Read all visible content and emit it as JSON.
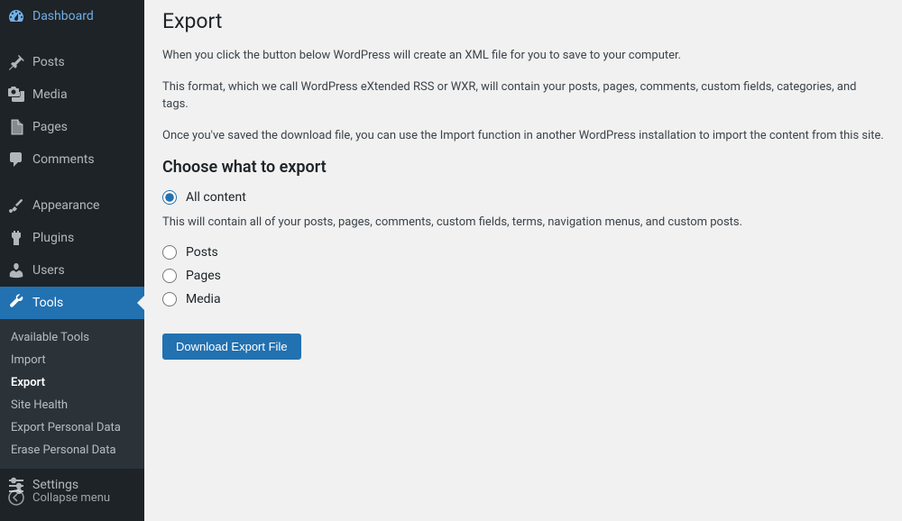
{
  "sidebar": {
    "dashboard": "Dashboard",
    "posts": "Posts",
    "media": "Media",
    "pages": "Pages",
    "comments": "Comments",
    "appearance": "Appearance",
    "plugins": "Plugins",
    "users": "Users",
    "tools": "Tools",
    "settings": "Settings",
    "collapse": "Collapse menu",
    "submenu": {
      "available_tools": "Available Tools",
      "import": "Import",
      "export": "Export",
      "site_health": "Site Health",
      "export_personal": "Export Personal Data",
      "erase_personal": "Erase Personal Data"
    }
  },
  "main": {
    "title": "Export",
    "p1": "When you click the button below WordPress will create an XML file for you to save to your computer.",
    "p2": "This format, which we call WordPress eXtended RSS or WXR, will contain your posts, pages, comments, custom fields, categories, and tags.",
    "p3": "Once you've saved the download file, you can use the Import function in another WordPress installation to import the content from this site.",
    "choose_heading": "Choose what to export",
    "opt_all": "All content",
    "opt_all_desc": "This will contain all of your posts, pages, comments, custom fields, terms, navigation menus, and custom posts.",
    "opt_posts": "Posts",
    "opt_pages": "Pages",
    "opt_media": "Media",
    "download_btn": "Download Export File"
  }
}
